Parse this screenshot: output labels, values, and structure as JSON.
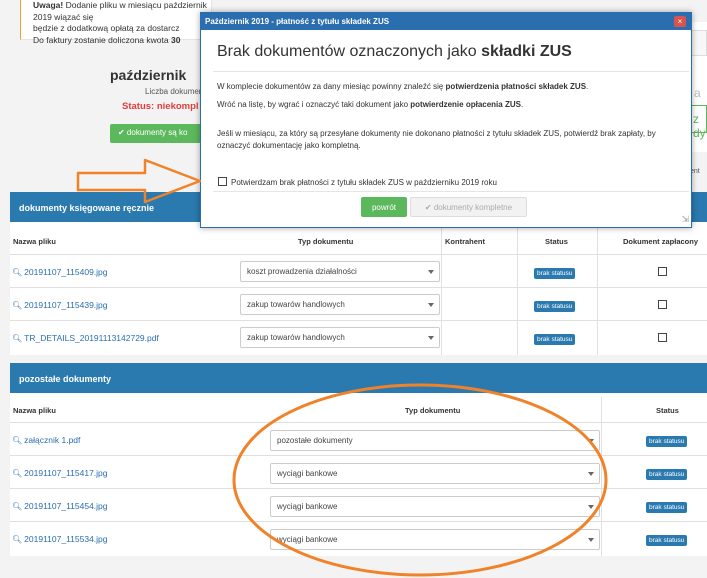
{
  "background": {
    "warning": {
      "bold": "Uwaga!",
      "line1": " Dodanie pliku w miesiącu październik 2019 wiązać się",
      "line2": "będzie z dodatkową opłatą za dostarcz",
      "line3": "Do faktury zostanie doliczona kwota ",
      "line3_bold": "30"
    },
    "month_title": "październik",
    "docs_count": "Liczba dokument",
    "status_label": "Status: ",
    "status_value": "niekompl",
    "green_button": "✔ dokumenty są ko",
    "right_partial_a": "a",
    "right_partial_btn": "z dy",
    "right_partial_text": "ent"
  },
  "section1": {
    "title": "dokumenty księgowane ręcznie",
    "headers": [
      "Nazwa pliku",
      "Typ dokumentu",
      "Kontrahent",
      "Status",
      "Dokument zapłacony"
    ],
    "rows": [
      {
        "file": "20191107_115409.jpg",
        "type": "koszt prowadzenia działalności",
        "status": "brak statusu"
      },
      {
        "file": "20191107_115439.jpg",
        "type": "zakup towarów handlowych",
        "status": "brak statusu"
      },
      {
        "file": "TR_DETAILS_20191113142729.pdf",
        "type": "zakup towarów handlowych",
        "status": "brak statusu"
      }
    ]
  },
  "section2": {
    "title": "pozostałe dokumenty",
    "headers": [
      "Nazwa pliku",
      "Typ dokumentu",
      "Status"
    ],
    "rows": [
      {
        "file": "załącznik 1.pdf",
        "type": "pozostałe dokumenty",
        "status": "brak statusu"
      },
      {
        "file": "20191107_115417.jpg",
        "type": "wyciągi bankowe",
        "status": "brak statusu"
      },
      {
        "file": "20191107_115454.jpg",
        "type": "wyciągi bankowe",
        "status": "brak statusu"
      },
      {
        "file": "20191107_115534.jpg",
        "type": "wyciągi bankowe",
        "status": "brak statusu"
      }
    ]
  },
  "modal": {
    "header": "Październik 2019 - płatność z tytułu składek ZUS",
    "close": "×",
    "title_normal": "Brak dokumentów oznaczonych jako ",
    "title_bold": "składki ZUS",
    "p1_a": "W komplecie dokumentów za dany miesiąc powinny znaleźć się ",
    "p1_b": "potwierdzenia płatności składek ZUS",
    "p1_c": ".",
    "p2_a": "Wróć na listę, by wgrać i oznaczyć taki dokument jako ",
    "p2_b": "potwierdzenie opłacenia ZUS",
    "p2_c": ".",
    "p3": "Jeśli w miesiącu, za który są przesyłane dokumenty nie dokonano płatności z tytułu składek ZUS, potwierdź brak zapłaty, by oznaczyć dokumentację jako kompletną.",
    "checkbox_label": "Potwierdzam brak płatności z tytułu składek ZUS w październiku 2019 roku",
    "back_button": "powrót",
    "complete_button": "✔ dokumenty kompletne"
  },
  "colors": {
    "header_blue": "#2a7ab0",
    "green": "#5cb85c",
    "annotation_orange": "#f0822a",
    "link_blue": "#2a6eb0"
  }
}
